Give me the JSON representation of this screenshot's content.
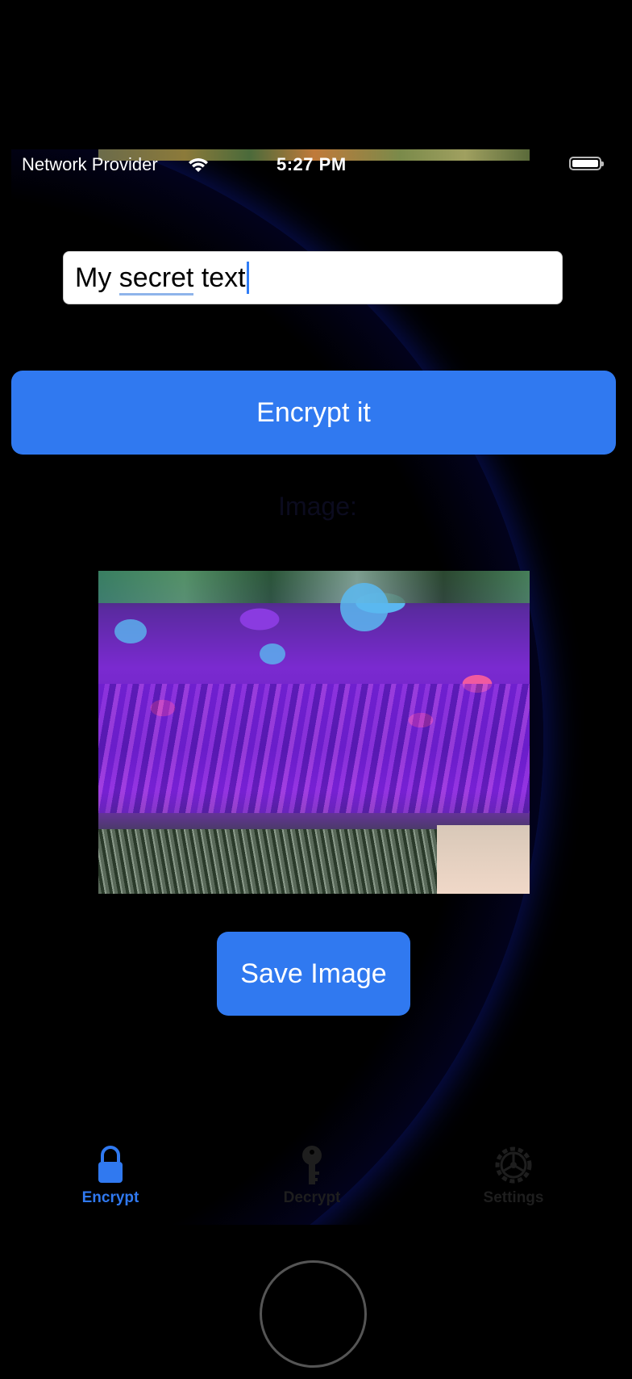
{
  "status_bar": {
    "carrier": "Network Provider",
    "time": "5:27 PM",
    "wifi_icon": "wifi-icon",
    "battery_icon": "battery-icon"
  },
  "text_field": {
    "value": "My secret text",
    "value_parts": [
      "My ",
      "secret",
      " text"
    ]
  },
  "encrypt_button": {
    "label": "Encrypt it"
  },
  "result_label": {
    "text": "Image:"
  },
  "image_preview": {
    "description_icon": "photo-image"
  },
  "save_button": {
    "label": "Save Image"
  },
  "tab_bar": {
    "tabs": [
      {
        "label": "Encrypt",
        "icon": "lock-icon",
        "active": true
      },
      {
        "label": "Decrypt",
        "icon": "key-icon",
        "active": false
      },
      {
        "label": "Settings",
        "icon": "gear-icon",
        "active": false
      }
    ]
  },
  "colors": {
    "accent": "#3079f0",
    "background": "#000000"
  }
}
